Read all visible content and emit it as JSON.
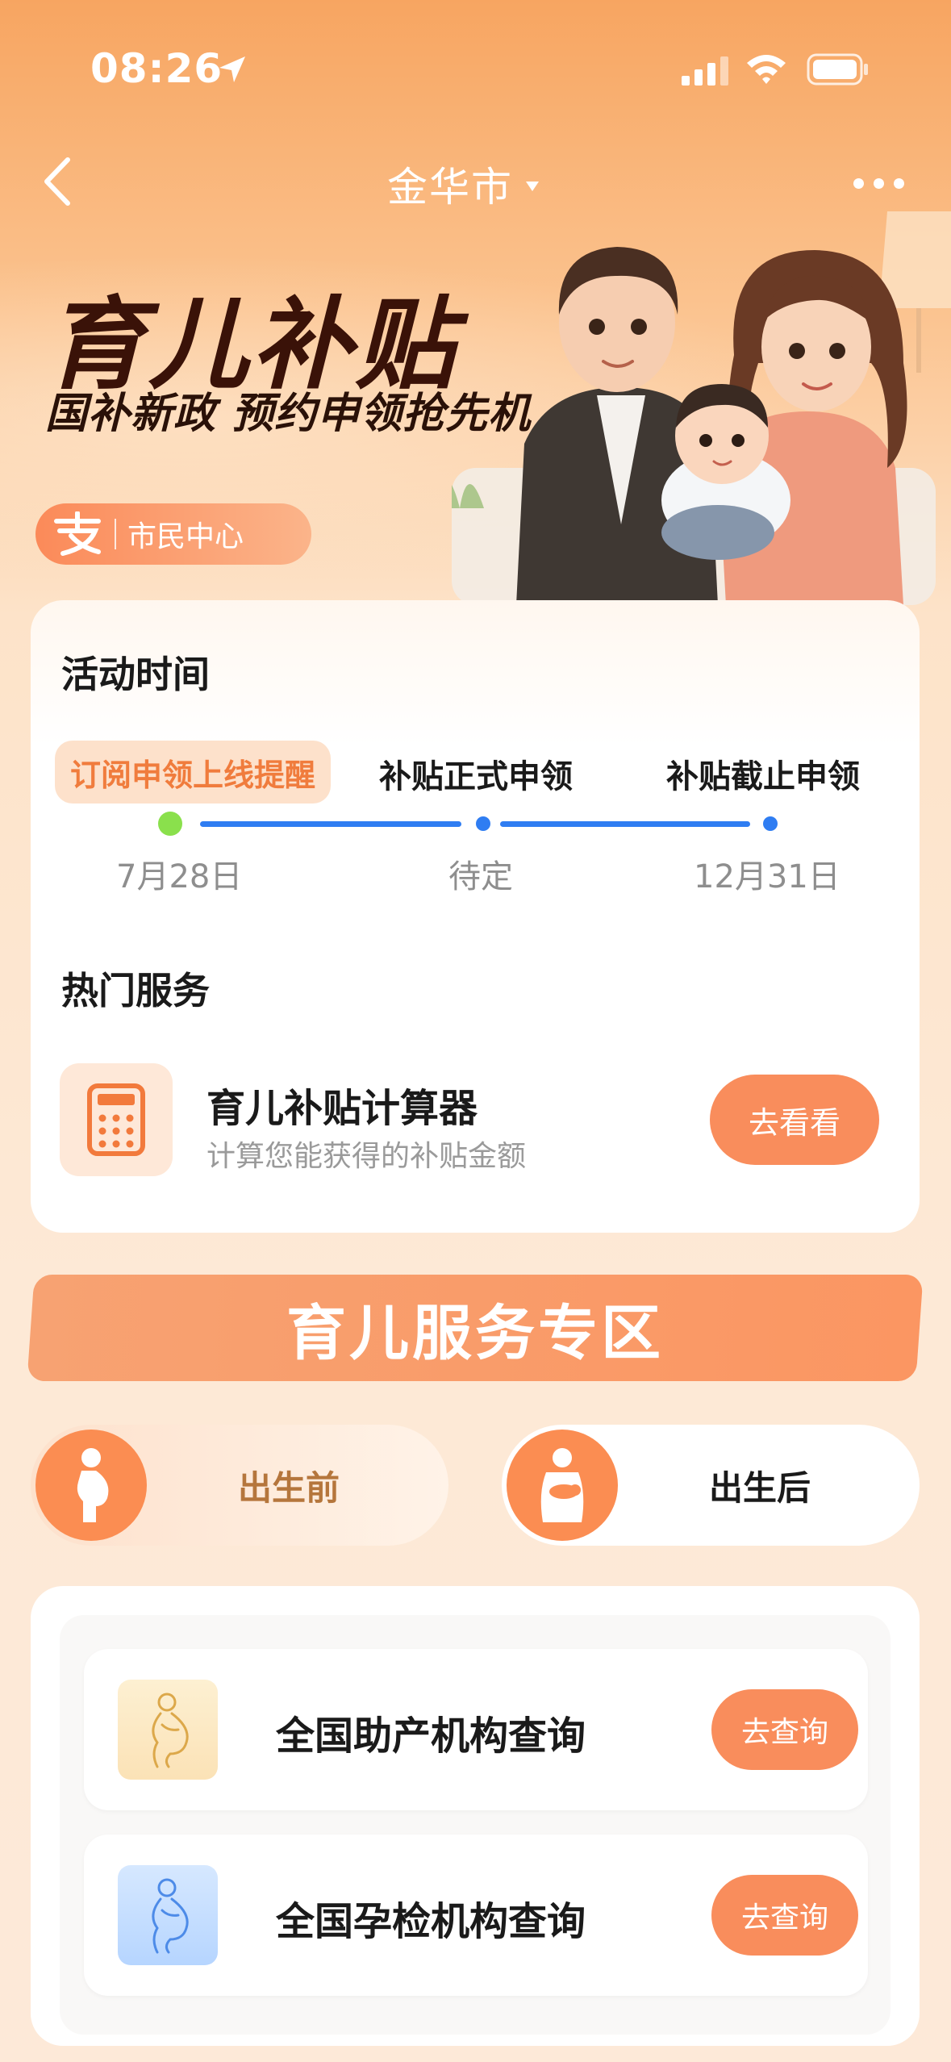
{
  "status_bar": {
    "time": "08:26"
  },
  "nav": {
    "city": "金华市"
  },
  "hero": {
    "title": "育儿补贴",
    "subtitle": "国补新政 预约申领抢先机",
    "badge_label": "市民中心"
  },
  "activity": {
    "title": "活动时间",
    "stages": [
      {
        "label": "订阅申领上线提醒",
        "date": "7月28日"
      },
      {
        "label": "补贴正式申领",
        "date": "待定"
      },
      {
        "label": "补贴截止申领",
        "date": "12月31日"
      }
    ]
  },
  "hot_services": {
    "title": "热门服务",
    "calculator": {
      "title": "育儿补贴计算器",
      "desc": "计算您能获得的补贴金额",
      "button": "去看看"
    }
  },
  "zone": {
    "title": "育儿服务专区",
    "tabs": [
      {
        "label": "出生前"
      },
      {
        "label": "出生后"
      }
    ]
  },
  "institutions": [
    {
      "label": "全国助产机构查询",
      "button": "去查询"
    },
    {
      "label": "全国孕检机构查询",
      "button": "去查询"
    }
  ],
  "colors": {
    "accent": "#f98d5c",
    "hero_title": "#3a1208",
    "timeline": "#2f7df2",
    "timeline_active": "#8ae04c"
  }
}
